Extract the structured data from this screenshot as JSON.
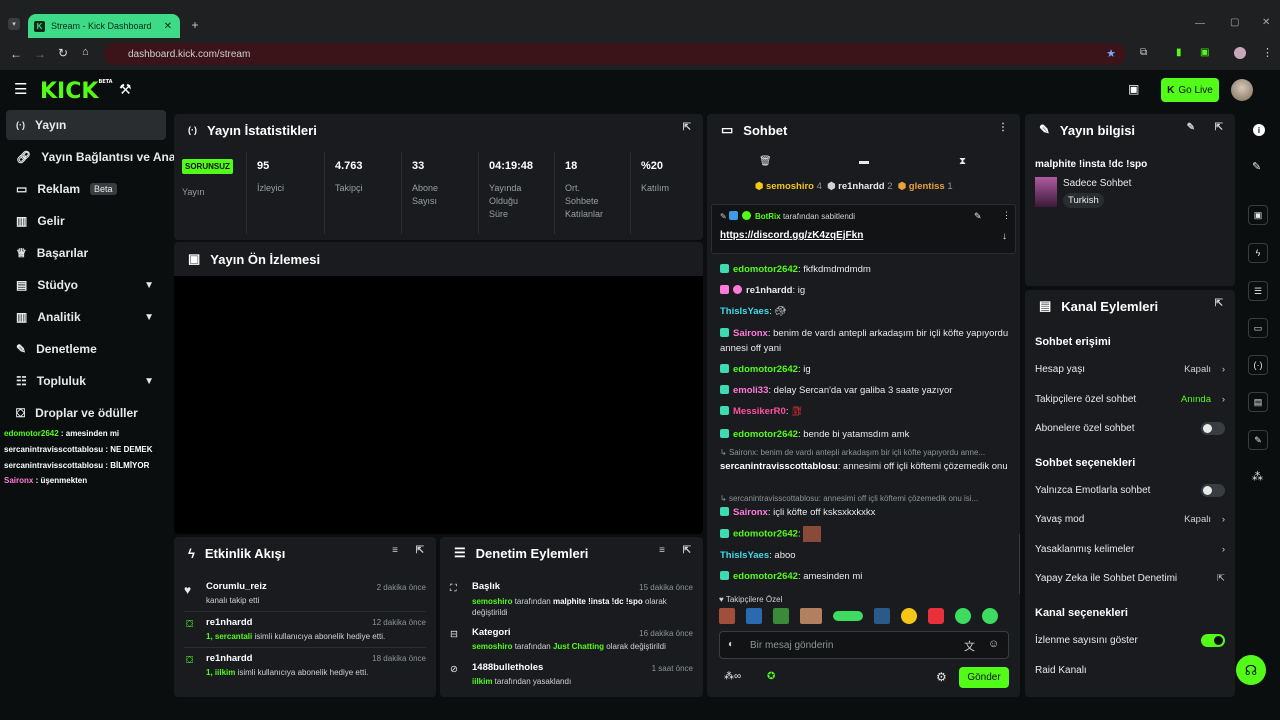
{
  "browser": {
    "tab_title": "Stream - Kick Dashboard",
    "url": "dashboard.kick.com/stream"
  },
  "header": {
    "logo": "KICK",
    "logo_badge": "BETA",
    "go_live": "Go Live"
  },
  "sidebar": {
    "items": [
      {
        "label": "Yayın",
        "icon": "broadcast-icon"
      },
      {
        "label": "Yayın Bağlantısı ve Anahtarı",
        "icon": "link-icon"
      },
      {
        "label": "Reklam",
        "icon": "ad-icon",
        "badge": "Beta"
      },
      {
        "label": "Gelir",
        "icon": "chart-icon"
      },
      {
        "label": "Başarılar",
        "icon": "trophy-icon"
      },
      {
        "label": "Stüdyo",
        "icon": "studio-icon"
      },
      {
        "label": "Analitik",
        "icon": "analytics-icon"
      },
      {
        "label": "Denetleme",
        "icon": "wrench-icon"
      },
      {
        "label": "Topluluk",
        "icon": "community-icon"
      },
      {
        "label": "Droplar ve ödüller",
        "icon": "gift-icon"
      }
    ],
    "chat": [
      {
        "user": "edomotor2642",
        "text": " : amesinden mi",
        "color": "#53fc18"
      },
      {
        "user": "sercanintravisscottablosu",
        "text": " : NE DEMEK",
        "color": "#ffffff"
      },
      {
        "user": "sercanintravisscottablosu",
        "text": " : BİLMİYOR",
        "color": "#ffffff"
      },
      {
        "user": "Saironx",
        "text": " : üşenmekten",
        "color": "#ff7ad9"
      }
    ]
  },
  "stats": {
    "title": "Yayın İstatistikleri",
    "status_badge": "SORUNSUZ",
    "status_label": "Yayın",
    "cells": [
      {
        "value": "95",
        "label": "İzleyici"
      },
      {
        "value": "4.763",
        "label": "Takipçi"
      },
      {
        "value": "33",
        "label": "Abone Sayısı"
      },
      {
        "value": "04:19:48",
        "label": "Yayında Olduğu Süre"
      },
      {
        "value": "18",
        "label": "Ort. Sohbete Katılanlar"
      },
      {
        "value": "%20",
        "label": "Katılım"
      }
    ]
  },
  "preview": {
    "title": "Yayın Ön İzlemesi"
  },
  "activity": {
    "title": "Etkinlik Akışı",
    "events": [
      {
        "user": "Corumlu_reiz",
        "text": "kanalı takip etti",
        "time": "2 dakika önce"
      },
      {
        "user": "re1nhardd",
        "highlight": "1, sercantali",
        "text": " isimli kullanıcıya abonelik hediye etti.",
        "time": "12 dakika önce"
      },
      {
        "user": "re1nhardd",
        "highlight": "1, iilkim",
        "text": " isimli kullanıcıya abonelik hediye etti.",
        "time": "18 dakika önce"
      }
    ]
  },
  "modactions": {
    "title": "Denetim Eylemleri",
    "items": [
      {
        "title": "Başlık",
        "time": "15 dakika önce",
        "actor": "semoshiro",
        "mid": " tarafından ",
        "target": "malphite !insta !dc !spo",
        "end": " olarak değiştirildi"
      },
      {
        "title": "Kategori",
        "time": "16 dakika önce",
        "actor": "semoshiro",
        "mid": " tarafından ",
        "target": "Just Chatting",
        "end": " olarak değiştirildi"
      },
      {
        "title": "1488bulletholes",
        "time": "1 saat önce",
        "actor": "iilkim",
        "mid": " tarafından yasaklandı",
        "target": "",
        "end": ""
      }
    ]
  },
  "chat": {
    "title": "Sohbet",
    "top_gifters": [
      {
        "name": "semoshiro",
        "count": "4",
        "color": "#f5c518"
      },
      {
        "name": "re1nhardd",
        "count": "2",
        "color": "#e8eaea"
      },
      {
        "name": "glentiss",
        "count": "1",
        "color": "#e8a23a"
      }
    ],
    "pinned": {
      "by": "BotRix",
      "by_suffix": "tarafından sabitlendi",
      "link": "https://discord.gg/zK4zqEjFkn"
    },
    "messages": [
      {
        "user": "edomotor2642",
        "color": "#53fc18",
        "text": "fkfkdmdmdmdm"
      },
      {
        "user": "re1nhardd",
        "color": "#e8eaea",
        "text": "ig"
      },
      {
        "user": "ThisIsYaes",
        "color": "#3ddbe8",
        "text": ""
      },
      {
        "user": "Saironx",
        "color": "#ff7ad9",
        "text": "benim de vardı antepli arkadaşım bir içli köfte yapıyordu annesi off yani"
      },
      {
        "user": "edomotor2642",
        "color": "#53fc18",
        "text": "ig"
      },
      {
        "user": "emoli33",
        "color": "#ff7ad9",
        "text": "delay Sercan'da var galiba 3 saate yazıyor"
      },
      {
        "user": "MessikerR0",
        "color": "#ff4fa0",
        "text": ""
      },
      {
        "user": "edomotor2642",
        "color": "#53fc18",
        "text": "bende bi yatamsdım amk"
      },
      {
        "reply": "Saironx: benim de vardı antepli arkadaşım bir içli köfte yapıyordu anne...",
        "user": "sercanintravisscottablosu",
        "color": "#ffffff",
        "text": "annesimi off içli köftemi çözemedik onu"
      },
      {
        "reply": "sercanintravisscottablosu: annesimi off içli köftemi çözemedik onu isi...",
        "user": "Saironx",
        "color": "#ff7ad9",
        "text": "içli köfte off ksksxkxkxkx"
      },
      {
        "user": "edomotor2642",
        "color": "#53fc18",
        "text": ""
      },
      {
        "user": "ThisIsYaes",
        "color": "#3ddbe8",
        "text": "aboo"
      },
      {
        "user": "edomotor2642",
        "color": "#53fc18",
        "text": "amesinden mi"
      }
    ],
    "emote_header": "Takipçilere Özel",
    "input_placeholder": "Bir mesaj gönderin",
    "send": "Gönder"
  },
  "streaminfo": {
    "title": "Yayın bilgisi",
    "stream_title": "malphite !insta !dc !spo",
    "category": "Sadece Sohbet",
    "tag": "Turkish"
  },
  "channel": {
    "title": "Kanal Eylemleri",
    "sections": {
      "chat_access": "Sohbet erişimi",
      "chat_options": "Sohbet seçenekleri",
      "channel_options": "Kanal seçenekleri"
    },
    "rows": {
      "account_age": {
        "label": "Hesap yaşı",
        "value": "Kapalı"
      },
      "followers_only": {
        "label": "Takipçilere özel sohbet",
        "value": "Anında"
      },
      "subs_only": {
        "label": "Abonelere özel sohbet"
      },
      "emote_only": {
        "label": "Yalnızca Emotlarla sohbet"
      },
      "slow_mode": {
        "label": "Yavaş mod",
        "value": "Kapalı"
      },
      "banned_words": {
        "label": "Yasaklanmış kelimeler"
      },
      "ai_mod": {
        "label": "Yapay Zeka ile Sohbet Denetimi"
      },
      "show_viewers": {
        "label": "İzlenme sayısını göster"
      },
      "raid": {
        "label": "Raid Kanalı"
      }
    }
  },
  "colors": {
    "accent": "#53fc18",
    "bg": "#0b0e0f",
    "panel": "#191b1f"
  }
}
